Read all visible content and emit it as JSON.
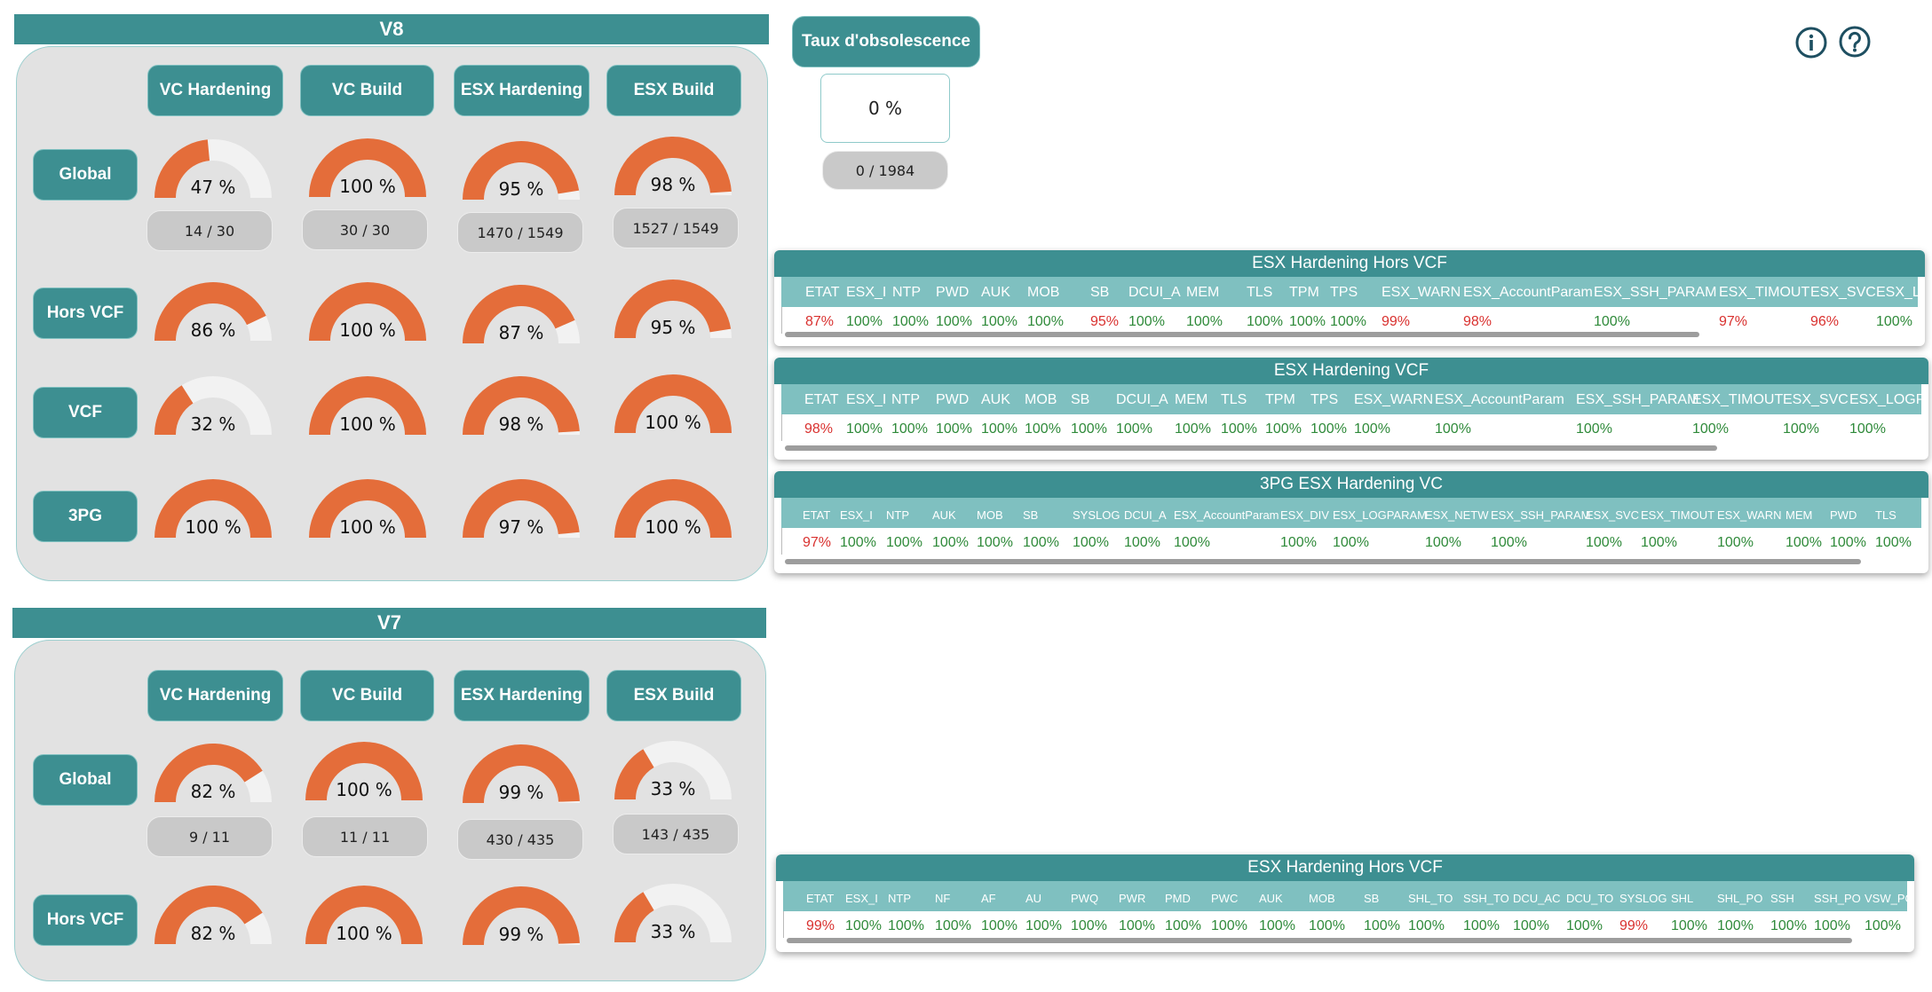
{
  "v8": {
    "title": "V8",
    "columns": [
      "VC Hardening",
      "VC Build",
      "ESX Hardening",
      "ESX Build"
    ],
    "rows": [
      {
        "label": "Global",
        "cells": [
          {
            "value": 0.47,
            "text": "47 %",
            "count": "14 / 30"
          },
          {
            "value": 1.0,
            "text": "100 %",
            "count": "30 / 30"
          },
          {
            "value": 0.95,
            "text": "95 %",
            "count": "1470 / 1549"
          },
          {
            "value": 0.98,
            "text": "98 %",
            "count": "1527 / 1549"
          }
        ]
      },
      {
        "label": "Hors VCF",
        "cells": [
          {
            "value": 0.86,
            "text": "86 %"
          },
          {
            "value": 1.0,
            "text": "100 %"
          },
          {
            "value": 0.87,
            "text": "87 %"
          },
          {
            "value": 0.95,
            "text": "95 %"
          }
        ]
      },
      {
        "label": "VCF",
        "cells": [
          {
            "value": 0.32,
            "text": "32 %"
          },
          {
            "value": 1.0,
            "text": "100 %"
          },
          {
            "value": 0.98,
            "text": "98 %"
          },
          {
            "value": 1.0,
            "text": "100 %"
          }
        ]
      },
      {
        "label": "3PG",
        "cells": [
          {
            "value": 1.0,
            "text": "100 %"
          },
          {
            "value": 1.0,
            "text": "100 %"
          },
          {
            "value": 0.97,
            "text": "97 %"
          },
          {
            "value": 1.0,
            "text": "100 %"
          }
        ]
      }
    ]
  },
  "v7": {
    "title": "V7",
    "columns": [
      "VC Hardening",
      "VC Build",
      "ESX Hardening",
      "ESX Build"
    ],
    "rows": [
      {
        "label": "Global",
        "cells": [
          {
            "value": 0.82,
            "text": "82 %",
            "count": "9 / 11"
          },
          {
            "value": 1.0,
            "text": "100 %",
            "count": "11 / 11"
          },
          {
            "value": 0.99,
            "text": "99 %",
            "count": "430 / 435"
          },
          {
            "value": 0.33,
            "text": "33 %",
            "count": "143 / 435"
          }
        ]
      },
      {
        "label": "Hors VCF",
        "cells": [
          {
            "value": 0.82,
            "text": "82 %"
          },
          {
            "value": 1.0,
            "text": "100 %"
          },
          {
            "value": 0.99,
            "text": "99 %"
          },
          {
            "value": 0.33,
            "text": "33 %"
          }
        ]
      }
    ]
  },
  "obsolescence": {
    "button_label": "Taux d'obsolescence",
    "value": "0 %",
    "count": "0 / 1984"
  },
  "icons": {
    "info": "info-icon",
    "help": "help-icon"
  },
  "colors": {
    "teal": "#3d8f91",
    "teal_light": "#7fc0c0",
    "gauge_fill": "#e46d3a",
    "gauge_track": "#f2f2f2",
    "ok": "#2f8a3a",
    "ko": "#d9312f"
  },
  "tables": [
    {
      "title": "ESX Hardening Hors VCF",
      "columns": [
        "ETAT",
        "ESX_I",
        "NTP",
        "PWD",
        "AUK",
        "MOB",
        "SB",
        "DCUI_A",
        "MEM",
        "TLS",
        "TPM",
        "TPS",
        "ESX_WARN",
        "ESX_AccountParam",
        "ESX_SSH_PARAM",
        "ESX_TIMOUT",
        "ESX_SVC",
        "ESX_LC"
      ],
      "values": [
        "87%",
        "100%",
        "100%",
        "100%",
        "100%",
        "100%",
        "95%",
        "100%",
        "100%",
        "100%",
        "100%",
        "100%",
        "99%",
        "98%",
        "100%",
        "97%",
        "96%",
        "100%"
      ]
    },
    {
      "title": "ESX Hardening VCF",
      "columns": [
        "ETAT",
        "ESX_I",
        "NTP",
        "PWD",
        "AUK",
        "MOB",
        "SB",
        "DCUI_A",
        "MEM",
        "TLS",
        "TPM",
        "TPS",
        "ESX_WARN",
        "ESX_AccountParam",
        "ESX_SSH_PARAM",
        "ESX_TIMOUT",
        "ESX_SVC",
        "ESX_LOGPA"
      ],
      "values": [
        "98%",
        "100%",
        "100%",
        "100%",
        "100%",
        "100%",
        "100%",
        "100%",
        "100%",
        "100%",
        "100%",
        "100%",
        "100%",
        "100%",
        "100%",
        "100%",
        "100%",
        "100%"
      ]
    },
    {
      "title": "3PG ESX Hardening VC",
      "columns": [
        "ETAT",
        "ESX_I",
        "NTP",
        "AUK",
        "MOB",
        "SB",
        "SYSLOG",
        "DCUI_A",
        "ESX_AccountParam",
        "ESX_DIV",
        "ESX_LOGPARAM",
        "ESX_NETW",
        "ESX_SSH_PARAM",
        "ESX_SVC",
        "ESX_TIMOUT",
        "ESX_WARN",
        "MEM",
        "PWD",
        "TLS"
      ],
      "values": [
        "97%",
        "100%",
        "100%",
        "100%",
        "100%",
        "100%",
        "100%",
        "100%",
        "100%",
        "100%",
        "100%",
        "100%",
        "100%",
        "100%",
        "100%",
        "100%",
        "100%",
        "100%",
        "100%"
      ]
    },
    {
      "title": "ESX Hardening Hors VCF",
      "columns": [
        "ETAT",
        "ESX_I",
        "NTP",
        "NF",
        "AF",
        "AU",
        "PWQ",
        "PWR",
        "PMD",
        "PWC",
        "AUK",
        "MOB",
        "SB",
        "SHL_TO",
        "SSH_TO",
        "DCU_AC",
        "DCU_TO",
        "SYSLOG",
        "SHL",
        "SHL_PO",
        "SSH",
        "SSH_PO",
        "VSW_PO"
      ],
      "values": [
        "99%",
        "100%",
        "100%",
        "100%",
        "100%",
        "100%",
        "100%",
        "100%",
        "100%",
        "100%",
        "100%",
        "100%",
        "100%",
        "100%",
        "100%",
        "100%",
        "100%",
        "99%",
        "100%",
        "100%",
        "100%",
        "100%",
        "100%"
      ]
    }
  ]
}
